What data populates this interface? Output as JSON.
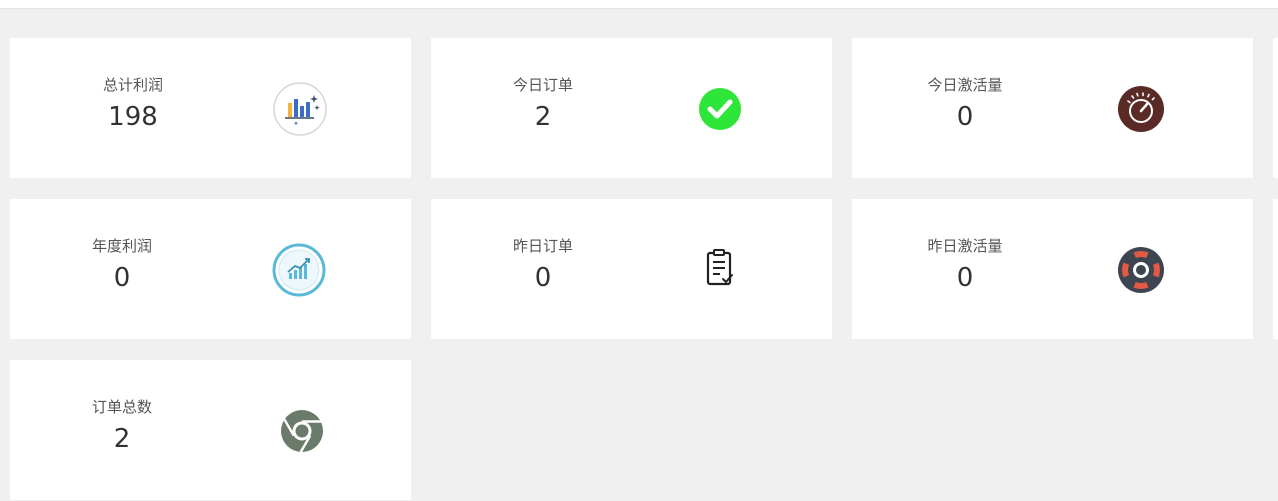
{
  "cards": [
    {
      "label": "总计利润",
      "value": "198",
      "icon": "bar-chart-icon"
    },
    {
      "label": "今日订单",
      "value": "2",
      "icon": "green-check-icon"
    },
    {
      "label": "今日激活量",
      "value": "0",
      "icon": "speedometer-icon"
    },
    {
      "label": "年度利润",
      "value": "0",
      "icon": "growth-chart-icon"
    },
    {
      "label": "昨日订单",
      "value": "0",
      "icon": "clipboard-check-icon"
    },
    {
      "label": "昨日激活量",
      "value": "0",
      "icon": "lifebuoy-icon"
    },
    {
      "label": "订单总数",
      "value": "2",
      "icon": "chrome-icon"
    }
  ],
  "colors": {
    "background": "#f0f0f0",
    "card": "#ffffff",
    "check_green": "#2ee63a",
    "speedometer": "#5a2a26",
    "lifebuoy_dark": "#3d4650",
    "lifebuoy_red": "#e25a43",
    "chrome_green": "#6b7b6b",
    "growth_ring": "#5ab8d8"
  }
}
